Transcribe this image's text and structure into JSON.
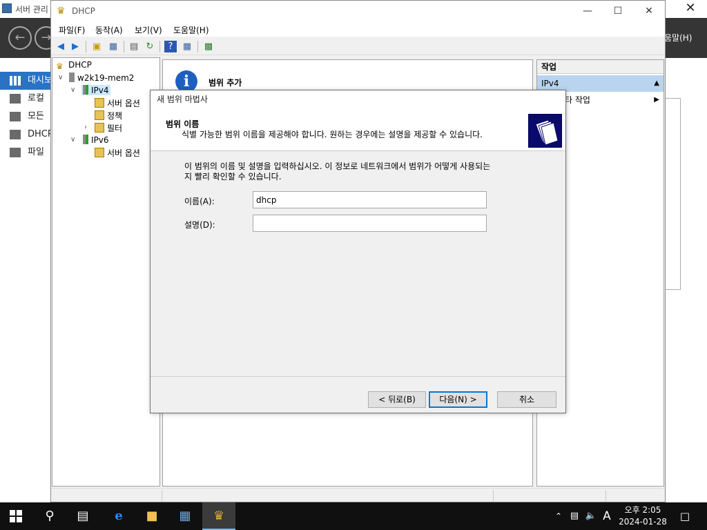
{
  "server_manager": {
    "title": "서버 관리",
    "close_glyph": "✕",
    "help_label": "움말(H)",
    "sidebar": [
      {
        "label": "대시보드",
        "active": true
      },
      {
        "label": "로컬",
        "active": false
      },
      {
        "label": "모든",
        "active": false
      },
      {
        "label": "DHCP",
        "active": false
      },
      {
        "label": "파일",
        "active": false
      }
    ]
  },
  "mmc": {
    "title": "DHCP",
    "menu": [
      "파일(F)",
      "동작(A)",
      "보기(V)",
      "도움말(H)"
    ],
    "tree": {
      "root": "DHCP",
      "server": "w2k19-mem2",
      "ipv4": "IPv4",
      "ipv4_children": [
        "서버 옵션",
        "정책",
        "필터"
      ],
      "ipv6": "IPv6",
      "ipv6_children": [
        "서버 옵션"
      ]
    },
    "center_title": "범위 추가",
    "actions": {
      "header": "작업",
      "section": "IPv4",
      "more": "타 작업"
    }
  },
  "wizard": {
    "title": "새 범위 마법사",
    "header_title": "범위 이름",
    "header_subtitle": "식별 가능한 범위 이름을 제공해야 합니다. 원하는 경우에는 설명을 제공할 수 있습니다.",
    "description_line1": "이 범위의 이름 및 설명을 입력하십시오. 이 정보로 네트워크에서 범위가 어떻게 사용되는",
    "description_line2": "지 빨리 확인할 수 있습니다.",
    "name_label": "이름(A):",
    "name_value": "dhcp",
    "desc_label": "설명(D):",
    "desc_value": "",
    "buttons": {
      "back": "< 뒤로(B)",
      "next": "다음(N) >",
      "cancel": "취소"
    }
  },
  "taskbar": {
    "ime": "A",
    "time": "오후 2:05",
    "date": "2024-01-28"
  },
  "colors": {
    "accent": "#0078d7",
    "sidebar_active": "#2a72c4",
    "action_highlight": "#b9d4ef",
    "nav_bar": "#353535",
    "taskbar": "#101010"
  }
}
